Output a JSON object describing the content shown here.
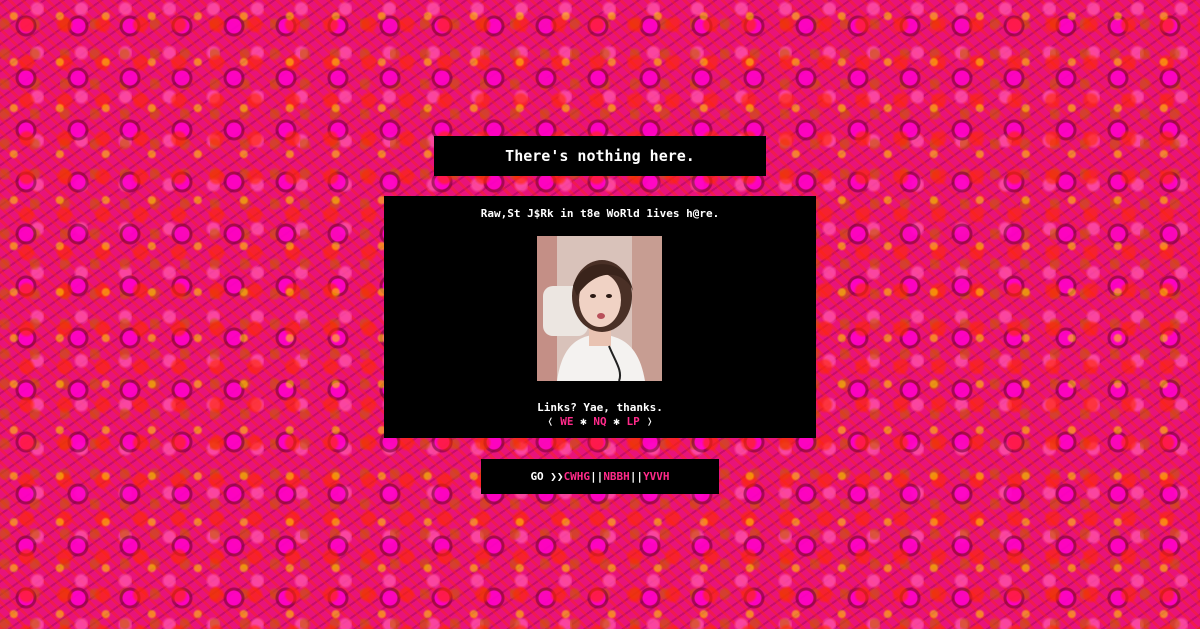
{
  "heading": "There's nothing here.",
  "tagline": "Raw,St J$Rk in t8e WoRld 1ives h@re.",
  "links_prompt": "Links? Yae, thanks.",
  "bracket_open": "❬",
  "bracket_close": "❭",
  "separator_star": "✱",
  "inline_links": [
    "WE",
    "NQ",
    "LP"
  ],
  "go_label": "GO ❯❯",
  "pipe": "||",
  "go_links": [
    "CWHG",
    "NBBH",
    "YVVH"
  ],
  "colors": {
    "panel_bg": "#000000",
    "text": "#ffffff",
    "link": "#ff2a8a",
    "page_bg": "#e8137a"
  }
}
